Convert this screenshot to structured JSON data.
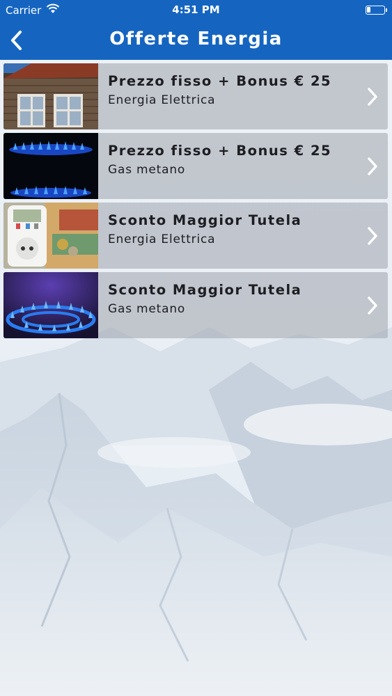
{
  "status_bar": {
    "carrier": "Carrier",
    "time": "4:51 PM",
    "icons": [
      "wifi-icon",
      "battery-icon"
    ]
  },
  "nav": {
    "title": "Offerte Energia",
    "back_icon": "chevron-left-icon"
  },
  "colors": {
    "brand_blue": "#1565c0",
    "row_background": "#a8acb4",
    "text_dark": "#1d1d22"
  },
  "offers": [
    {
      "title": "Prezzo fisso + Bonus € 25",
      "subtitle": "Energia Elettrica",
      "thumbnail": "house-window-image"
    },
    {
      "title": "Prezzo fisso + Bonus € 25",
      "subtitle": "Gas metano",
      "thumbnail": "gas-flame-image"
    },
    {
      "title": "Sconto Maggior Tutela",
      "subtitle": "Energia Elettrica",
      "thumbnail": "power-meter-money-image"
    },
    {
      "title": "Sconto Maggior Tutela",
      "subtitle": "Gas metano",
      "thumbnail": "gas-burner-ring-image"
    }
  ]
}
